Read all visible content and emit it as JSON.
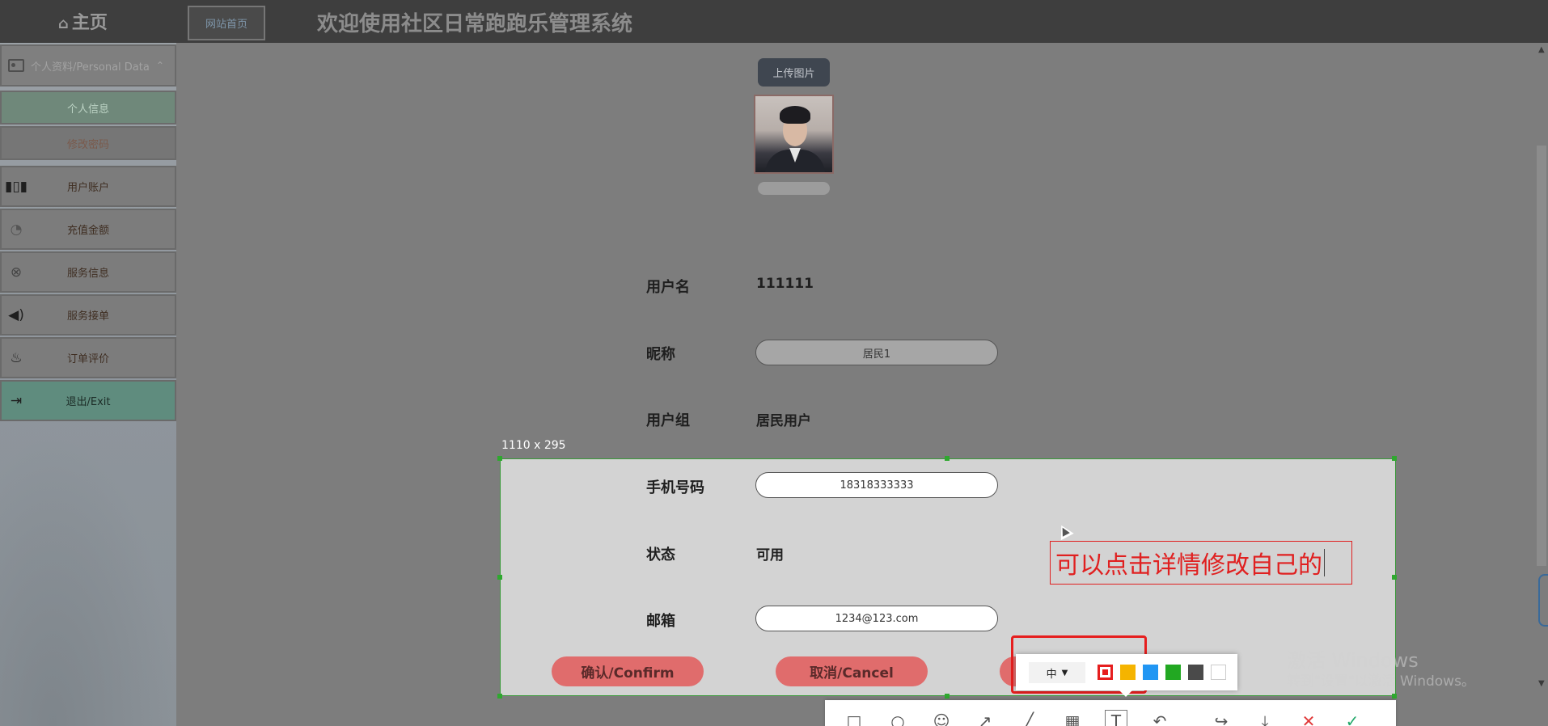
{
  "header": {
    "home_icon": "home-icon",
    "home_label": "主页",
    "site_home_button": "网站首页",
    "system_title": "欢迎使用社区日常跑跑乐管理系统"
  },
  "sidebar": {
    "group_label": "个人资料/Personal Data",
    "group_icon": "id-card-icon",
    "group_chevron": "chevron-up-icon",
    "sub_items": [
      {
        "label": "个人信息",
        "active": true
      },
      {
        "label": "修改密码",
        "active": false
      }
    ],
    "items": [
      {
        "label": "用户账户",
        "icon": "bookshelf-icon"
      },
      {
        "label": "充值金额",
        "icon": "gauge-icon"
      },
      {
        "label": "服务信息",
        "icon": "globe-icon"
      },
      {
        "label": "服务接单",
        "icon": "speaker-icon"
      },
      {
        "label": "订单评价",
        "icon": "flame-icon"
      },
      {
        "label": "退出/Exit",
        "icon": "logout-icon"
      }
    ]
  },
  "profile": {
    "upload_button": "上传图片",
    "fields": {
      "username": {
        "label": "用户名",
        "value": "111111"
      },
      "nickname": {
        "label": "昵称",
        "value": "居民1"
      },
      "user_group": {
        "label": "用户组",
        "value": "居民用户"
      },
      "phone": {
        "label": "手机号码",
        "value": "18318333333"
      },
      "status": {
        "label": "状态",
        "value": "可用"
      },
      "email": {
        "label": "邮箱",
        "value": "1234@123.com"
      }
    },
    "buttons": {
      "confirm": "确认/Confirm",
      "cancel": "取消/Cancel"
    }
  },
  "capture": {
    "selection_size": "1110 x 295",
    "annotation_text": "可以点击详情修改自己的",
    "size_option": "中",
    "colors": [
      "#e61e1e",
      "#f5b400",
      "#2196f3",
      "#22a822",
      "#4a4a4a",
      "#ffffff"
    ],
    "selected_color": "#e61e1e",
    "tools": [
      {
        "name": "rectangle-tool-icon",
        "glyph": "□"
      },
      {
        "name": "ellipse-tool-icon",
        "glyph": "○"
      },
      {
        "name": "emoji-tool-icon",
        "glyph": "☺"
      },
      {
        "name": "arrow-tool-icon",
        "glyph": "↗"
      },
      {
        "name": "line-tool-icon",
        "glyph": "╱"
      },
      {
        "name": "mosaic-tool-icon",
        "glyph": "▦"
      },
      {
        "name": "text-tool-icon",
        "glyph": "T"
      },
      {
        "name": "undo-icon",
        "glyph": "↶"
      },
      {
        "name": "share-icon",
        "glyph": "↪"
      },
      {
        "name": "download-icon",
        "glyph": "⤓"
      },
      {
        "name": "cancel-capture-icon",
        "glyph": "✕"
      },
      {
        "name": "confirm-capture-icon",
        "glyph": "✓"
      }
    ]
  },
  "watermark": {
    "line1": "激活 Windows",
    "line2": "转到\"设置\"以激活 Windows。"
  }
}
